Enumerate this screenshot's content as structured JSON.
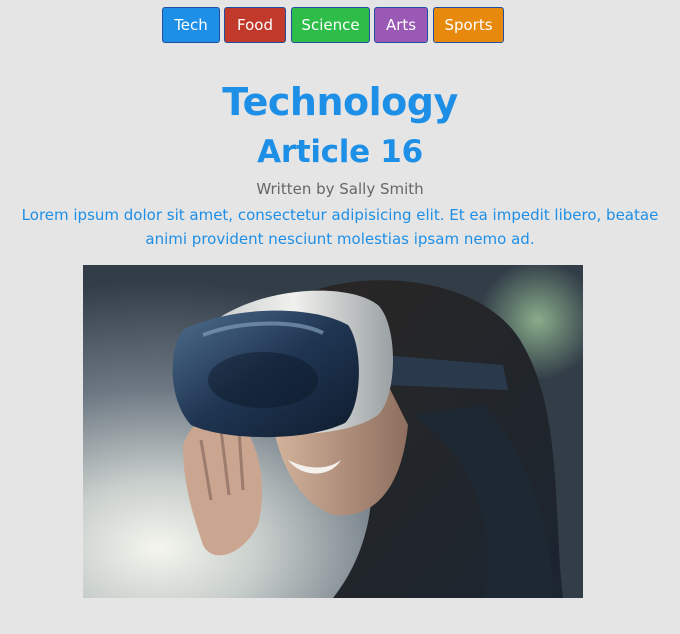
{
  "nav": {
    "items": [
      {
        "label": "Tech",
        "color": "#1e8fe6"
      },
      {
        "label": "Food",
        "color": "#c0392b"
      },
      {
        "label": "Science",
        "color": "#2ebd48"
      },
      {
        "label": "Arts",
        "color": "#9b59b6"
      },
      {
        "label": "Sports",
        "color": "#e6890c"
      }
    ]
  },
  "article": {
    "category": "Technology",
    "title": "Article 16",
    "byline": "Written by Sally Smith",
    "excerpt": "Lorem ipsum dolor sit amet, consectetur adipisicing elit. Et ea impedit libero, beatae animi provident nesciunt molestias ipsam nemo ad.",
    "image_subject": "woman-wearing-vr-headset-photo"
  },
  "colors": {
    "accent": "#1e8fe6",
    "byline": "#666666",
    "background": "#e5e5e5"
  }
}
